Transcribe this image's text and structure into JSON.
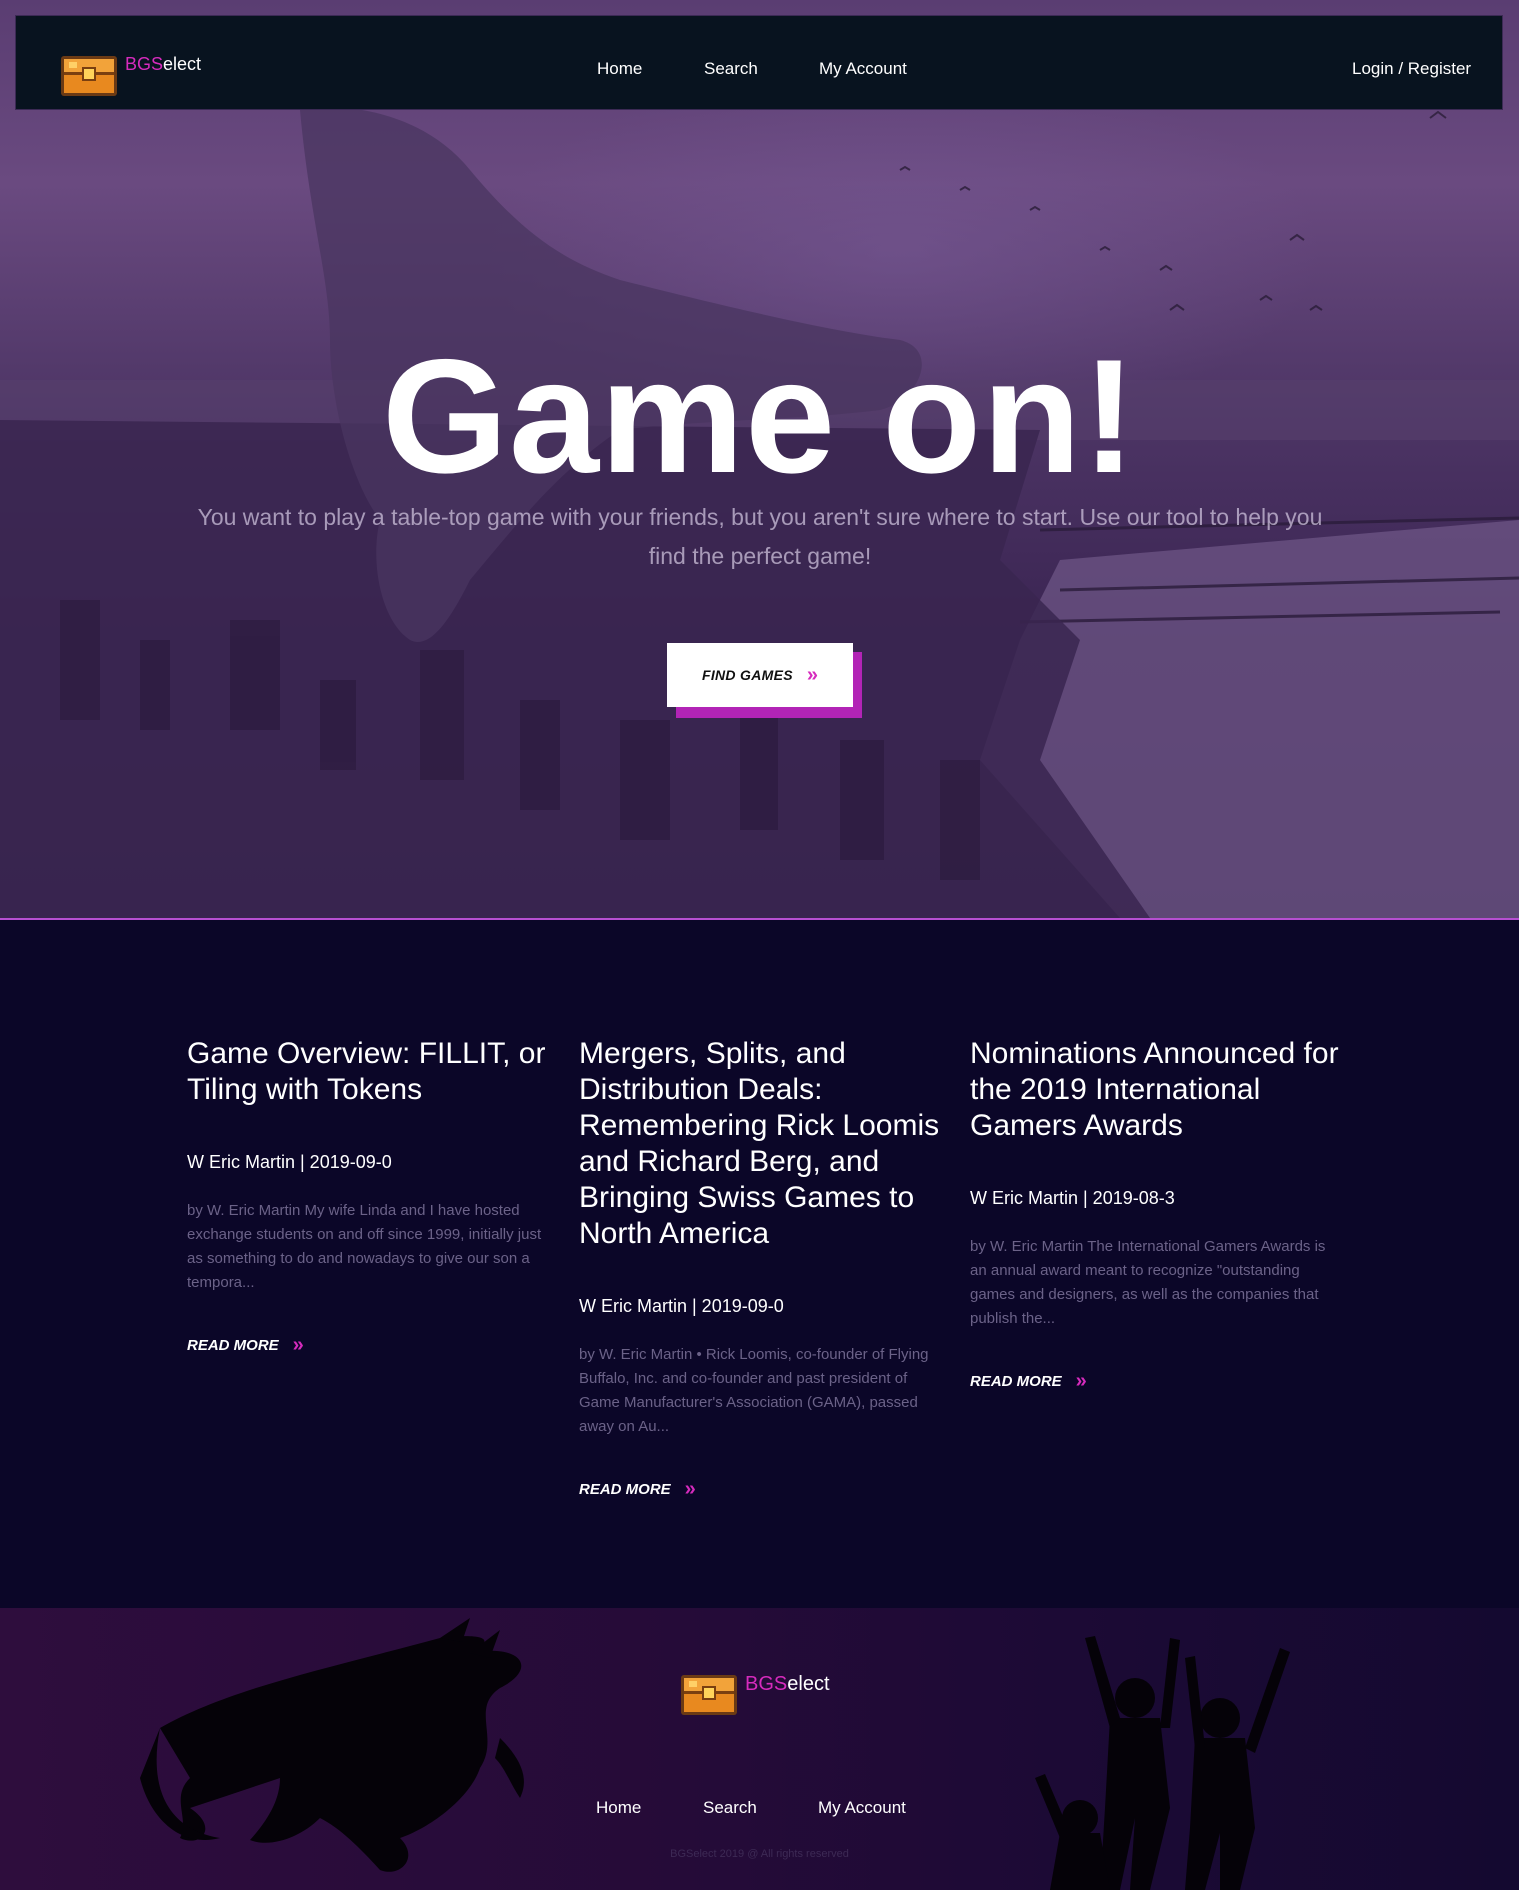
{
  "brand": {
    "highlight": "BGS",
    "rest": "elect"
  },
  "nav": {
    "links": [
      "Home",
      "Search",
      "My Account"
    ],
    "login": "Login / Register"
  },
  "hero": {
    "title": "Game on!",
    "subtitle": "You want to play a table-top game with your friends, but you aren't sure where to start. Use our tool to help you find the perfect game!",
    "cta_label": "FIND GAMES"
  },
  "articles": [
    {
      "title": "Game Overview: FILLIT, or Tiling with Tokens",
      "meta": "W Eric Martin | 2019-09-0",
      "excerpt": "by W. Eric Martin My wife Linda and I have hosted exchange students on and off since 1999, initially just as something to do and nowadays to give our son a tempora...",
      "read_more": "READ MORE"
    },
    {
      "title": "Mergers, Splits, and Distribution Deals: Remembering Rick Loomis and Richard Berg, and Bringing Swiss Games to North America",
      "meta": "W Eric Martin | 2019-09-0",
      "excerpt": "by W. Eric Martin • Rick Loomis, co-founder of Flying Buffalo, Inc. and co-founder and past president of Game Manufacturer's Association (GAMA), passed away on Au...",
      "read_more": "READ MORE"
    },
    {
      "title": "Nominations Announced for the 2019 International Gamers Awards",
      "meta": "W Eric Martin | 2019-08-3",
      "excerpt": "by W. Eric Martin The International Gamers Awards is an annual award meant to recognize \"outstanding games and designers, as well as the companies that publish the...",
      "read_more": "READ MORE"
    }
  ],
  "footer": {
    "links": [
      "Home",
      "Search",
      "My Account"
    ],
    "copyright": "BGSelect 2019 @ All rights reserved"
  },
  "colors": {
    "accent": "#d62bbd",
    "nav_bg": "#08131f",
    "page_bg": "#0b0628",
    "cta_shadow": "#b224b6"
  },
  "icons": {
    "logo": "treasure-chest-icon",
    "read_more": "double-chevron-right-icon"
  }
}
